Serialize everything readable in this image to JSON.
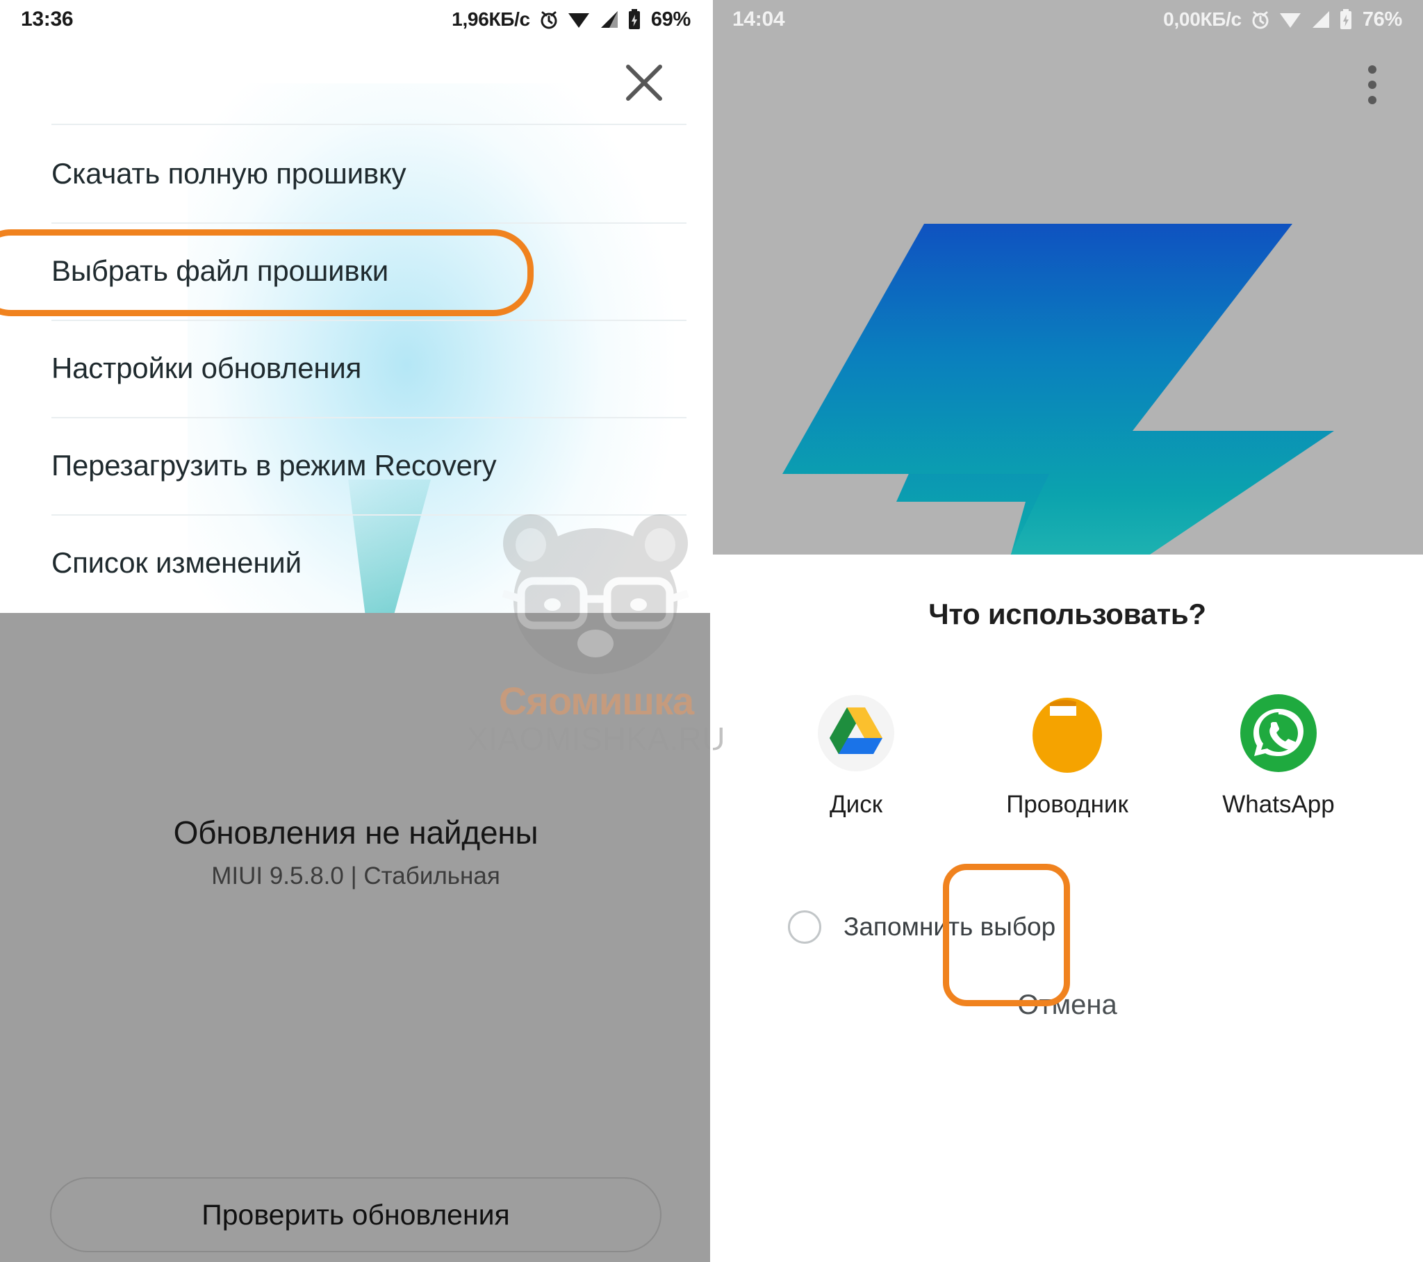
{
  "left_screen": {
    "status_bar": {
      "time": "13:36",
      "net_rate": "1,96КБ/с",
      "battery": "69%",
      "icons": [
        "alarm-icon",
        "wifi-icon",
        "signal-icon",
        "battery-icon"
      ]
    },
    "close_label": "×",
    "menu": {
      "items": [
        {
          "label": "Скачать полную прошивку",
          "highlighted": false
        },
        {
          "label": "Выбрать файл прошивки",
          "highlighted": true
        },
        {
          "label": "Настройки обновления",
          "highlighted": false
        },
        {
          "label": "Перезагрузить в режим Recovery",
          "highlighted": false
        },
        {
          "label": "Список изменений",
          "highlighted": false
        }
      ]
    },
    "status": {
      "title": "Обновления не найдены",
      "subtitle": "MIUI 9.5.8.0 | Стабильная"
    },
    "primary_button": "Проверить обновления"
  },
  "right_screen": {
    "status_bar": {
      "time": "14:04",
      "net_rate": "0,00КБ/с",
      "battery": "76%",
      "icons": [
        "alarm-icon",
        "wifi-icon",
        "signal-icon",
        "battery-icon"
      ]
    },
    "overflow_menu": "overflow-menu-icon",
    "chooser": {
      "title": "Что использовать?",
      "apps": [
        {
          "name": "Диск",
          "icon": "google-drive-icon",
          "highlighted": false
        },
        {
          "name": "Проводник",
          "icon": "file-explorer-icon",
          "highlighted": true
        },
        {
          "name": "WhatsApp",
          "icon": "whatsapp-icon",
          "highlighted": false
        }
      ],
      "remember_label": "Запомнить выбор",
      "remember_checked": false,
      "cancel_label": "Отмена"
    }
  },
  "watermark": {
    "line1": "Сяомишка",
    "line2": "XIAOMISHKA.RU",
    "mascot": "panda-glasses-icon"
  },
  "colors": {
    "highlight_orange": "#f0821e",
    "gray_background": "#9e9e9e",
    "gray_background_right": "#b3b3b3",
    "bolt_top": "#1062c4",
    "bolt_bottom": "#12b7a8",
    "whatsapp_green": "#25a93e",
    "explorer_orange": "#f5a300"
  }
}
